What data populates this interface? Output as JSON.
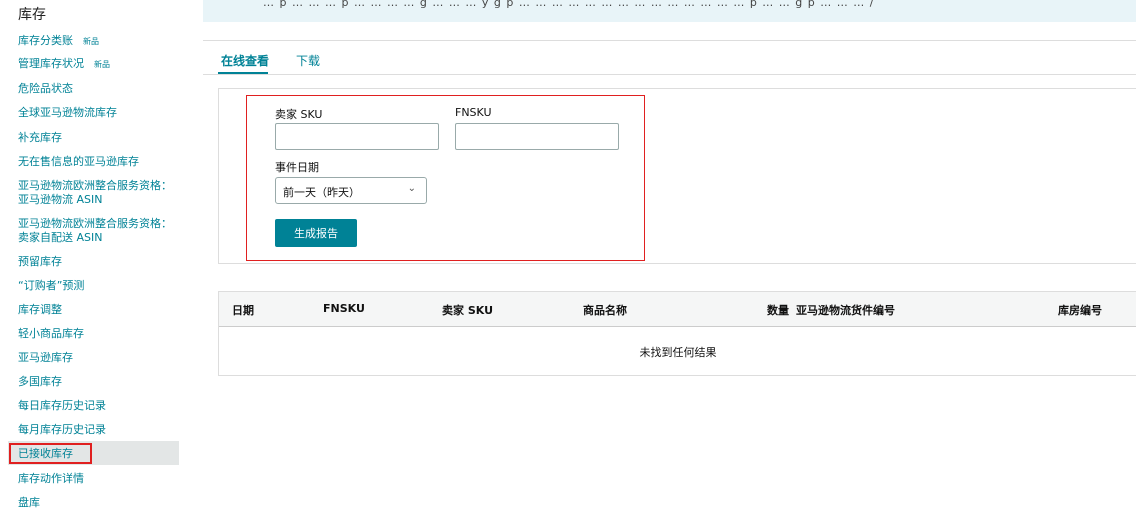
{
  "banner": {
    "text": "… p … … … p … … … … g … … … y g p … … … … … … … … … … … … … … p … … g p … … … /"
  },
  "sidebar": {
    "heading": "库存",
    "new_badge": "新品",
    "items": [
      {
        "label": "库存分类账"
      },
      {
        "label": "管理库存状况"
      },
      {
        "label": "危险品状态"
      },
      {
        "label": "全球亚马逊物流库存"
      },
      {
        "label": "补充库存"
      },
      {
        "label": "无在售信息的亚马逊库存"
      },
      {
        "label": "亚马逊物流欧洲整合服务资格：亚马逊物流 ASIN"
      },
      {
        "label": "亚马逊物流欧洲整合服务资格：卖家自配送 ASIN"
      },
      {
        "label": "预留库存"
      },
      {
        "label": "“订购者”预测"
      },
      {
        "label": "库存调整"
      },
      {
        "label": "轻小商品库存"
      },
      {
        "label": "亚马逊库存"
      },
      {
        "label": "多国库存"
      },
      {
        "label": "每日库存历史记录"
      },
      {
        "label": "每月库存历史记录"
      },
      {
        "label": "已接收库存"
      },
      {
        "label": "库存动作详情"
      },
      {
        "label": "盘库"
      }
    ]
  },
  "tabs": [
    {
      "label": "在线查看"
    },
    {
      "label": "下载"
    }
  ],
  "form": {
    "seller_sku_label": "卖家 SKU",
    "seller_sku_value": "",
    "fnsku_label": "FNSKU",
    "fnsku_value": "",
    "event_date_label": "事件日期",
    "event_date_selected": "前一天（昨天）",
    "generate_button": "生成报告"
  },
  "table": {
    "headers": [
      "日期",
      "FNSKU",
      "卖家 SKU",
      "商品名称",
      "数量",
      "亚马逊物流货件编号",
      "库房编号"
    ],
    "empty_message": "未找到任何结果"
  },
  "colors": {
    "accent": "#008296",
    "highlight_box": "#e02020"
  }
}
